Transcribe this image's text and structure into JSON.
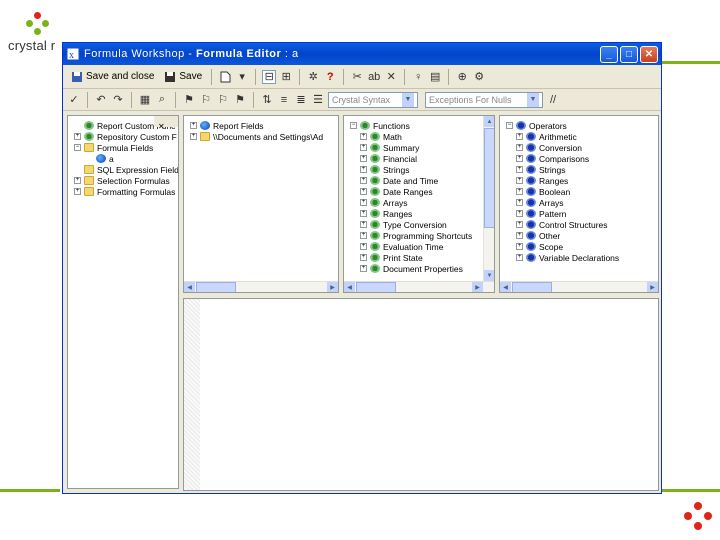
{
  "branding": {
    "logo_text": "crystal r",
    "logo_colors": [
      "#e2231a",
      "#7ab317"
    ]
  },
  "window": {
    "title_prefix": "Formula Workshop",
    "title_editor": "Formula Editor",
    "title_name": "a",
    "min_label": "_",
    "max_label": "□",
    "close_label": "✕"
  },
  "toolbar1": {
    "save_close_label": "Save and close",
    "save_label": "Save"
  },
  "toolbar2": {
    "syntax_combo": "Crystal Syntax",
    "nulls_combo": "Exceptions For Nulls"
  },
  "left_tree": {
    "items": [
      {
        "label": "Report Custom Func",
        "expander": "",
        "icon": "gear"
      },
      {
        "label": "Repository Custom F",
        "expander": "+",
        "icon": "gear"
      },
      {
        "label": "Formula Fields",
        "expander": "−",
        "icon": "folder"
      },
      {
        "label": "a",
        "expander": "",
        "icon": "formula",
        "indent": true
      },
      {
        "label": "SQL Expression Field",
        "expander": "",
        "icon": "folder"
      },
      {
        "label": "Selection Formulas",
        "expander": "+",
        "icon": "folder"
      },
      {
        "label": "Formatting Formulas",
        "expander": "+",
        "icon": "folder"
      }
    ]
  },
  "fields_tree": {
    "items": [
      {
        "label": "Report Fields",
        "expander": "+"
      },
      {
        "label": "\\\\Documents and Settings\\Ad",
        "expander": "+"
      }
    ]
  },
  "functions_tree": {
    "root": "Functions",
    "items": [
      "Math",
      "Summary",
      "Financial",
      "Strings",
      "Date and Time",
      "Date Ranges",
      "Arrays",
      "Ranges",
      "Type Conversion",
      "Programming Shortcuts",
      "Evaluation Time",
      "Print State",
      "Document Properties"
    ]
  },
  "operators_tree": {
    "root": "Operators",
    "items": [
      "Arithmetic",
      "Conversion",
      "Comparisons",
      "Strings",
      "Ranges",
      "Boolean",
      "Arrays",
      "Pattern",
      "Control Structures",
      "Other",
      "Scope",
      "Variable Declarations"
    ]
  }
}
